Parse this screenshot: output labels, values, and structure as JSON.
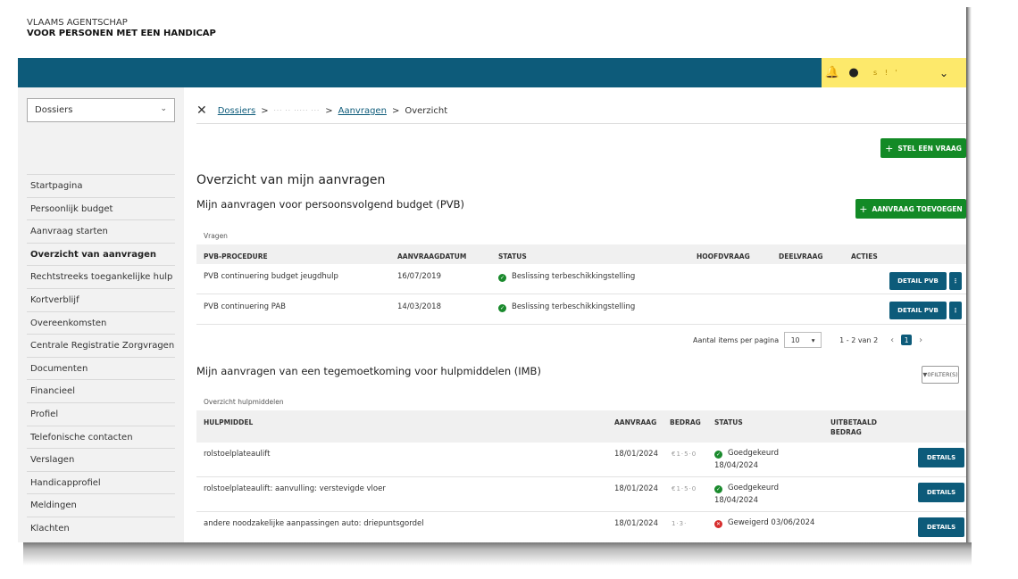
{
  "agency": {
    "line1": "VLAAMS AGENTSCHAP",
    "line2": "VOOR PERSONEN MET EEN HANDICAP"
  },
  "topbar": {
    "bell_icon": "bell-icon",
    "user_icon": "user-icon",
    "username": "s ! '",
    "chevron_icon": "chevron-down-icon",
    "accent": "#0d5b7a",
    "user_bg": "#fde96b"
  },
  "sidebar": {
    "select_value": "Dossiers",
    "items": [
      "Startpagina",
      "Persoonlijk budget",
      "Aanvraag starten",
      "Overzicht van aanvragen",
      "Rechtstreeks toegankelijke hulp",
      "Kortverblijf",
      "Overeenkomsten",
      "Centrale Registratie Zorgvragen",
      "Documenten",
      "Financieel",
      "Profiel",
      "Telefonische contacten",
      "Verslagen",
      "Handicapprofiel",
      "Meldingen",
      "Klachten"
    ]
  },
  "breadcrumb": {
    "close": "✕",
    "dossiers": "Dossiers",
    "sep": ">",
    "blurred": "··· ·· ····· ···",
    "aanvragen": "Aanvragen",
    "current": "Overzicht"
  },
  "buttons": {
    "stel_vraag": "STEL EEN VRAAG",
    "aanvraag_toevoegen": "AANVRAAG TOEVOEGEN",
    "detail_pvb": "DETAIL PVB",
    "details": "DETAILS",
    "filter": "0FILTER(S)",
    "plus": "+",
    "more": "⋮"
  },
  "page": {
    "title": "Overzicht van mijn aanvragen",
    "pvb_heading": "Mijn aanvragen voor persoonsvolgend budget (PVB)",
    "imb_heading": "Mijn aanvragen van een tegemoetkoming voor hulpmiddelen (IMB)"
  },
  "pvb_table": {
    "caption": "Vragen",
    "headers": [
      "PVB-PROCEDURE",
      "AANVRAAGDATUM",
      "STATUS",
      "HOOFDVRAAG",
      "DEELVRAAG",
      "ACTIES"
    ],
    "rows": [
      {
        "procedure": "PVB continuering budget jeugdhulp",
        "datum": "16/07/2019",
        "status": "Beslissing terbeschikkingstelling"
      },
      {
        "procedure": "PVB continuering PAB",
        "datum": "14/03/2018",
        "status": "Beslissing terbeschikkingstelling"
      }
    ]
  },
  "pager": {
    "label": "Aantal items per pagina",
    "per_page": "10",
    "range": "1 - 2 van 2",
    "page": "1",
    "prev": "‹",
    "next": "›"
  },
  "imb_table": {
    "caption": "Overzicht hulpmiddelen",
    "headers": [
      "HULPMIDDEL",
      "AANVRAAG",
      "BEDRAG",
      "STATUS",
      "UITBETAALD",
      "BEDRAG"
    ],
    "rows": [
      {
        "hulpmiddel": "rolstoelplateaulift",
        "aanvraag": "18/01/2024",
        "bedrag": "€1·5·0",
        "status": "Goedgekeurd",
        "status_date": "18/04/2024",
        "ok": true
      },
      {
        "hulpmiddel": "rolstoelplateaulift: aanvulling: verstevigde vloer",
        "aanvraag": "18/01/2024",
        "bedrag": "€1·5·0",
        "status": "Goedgekeurd",
        "status_date": "18/04/2024",
        "ok": true
      },
      {
        "hulpmiddel": "andere noodzakelijke aanpassingen auto: driepuntsgordel",
        "aanvraag": "18/01/2024",
        "bedrag": "1·3·",
        "status": "Geweigerd 03/06/2024",
        "status_date": "",
        "ok": false
      }
    ]
  }
}
